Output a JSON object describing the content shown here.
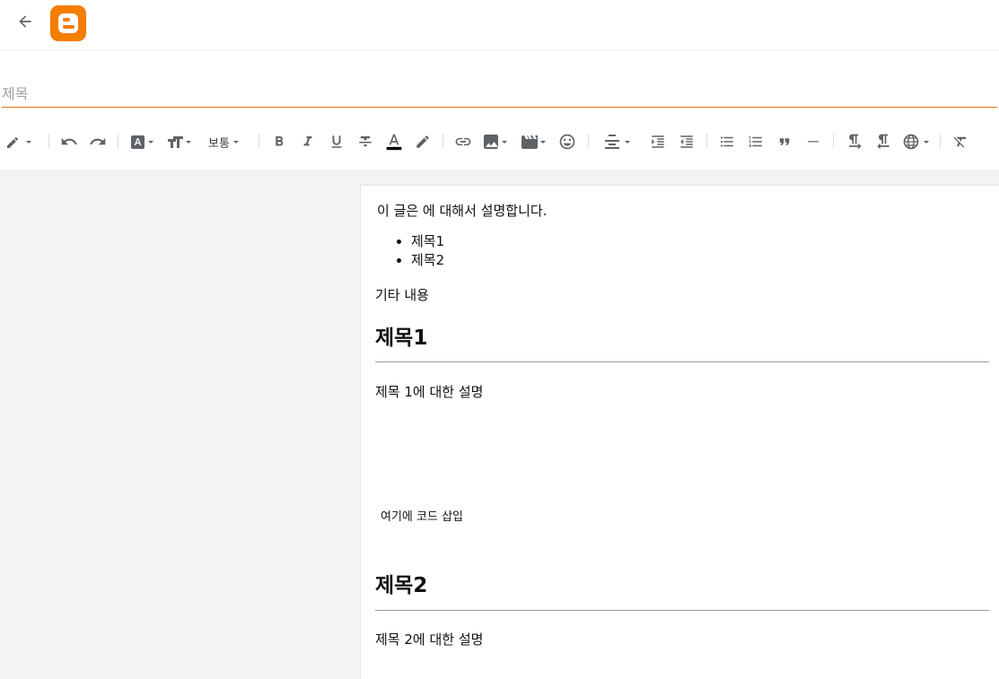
{
  "topbar": {
    "back_icon": "arrow-left-icon",
    "logo_icon": "blogger-logo-icon",
    "logo_color": "#f57d00"
  },
  "title_field": {
    "placeholder": "제목",
    "value": "",
    "underline_color": "#e8710a"
  },
  "toolbar": {
    "font_size_label": "보통",
    "icon_color": "#5f6368",
    "buttons": [
      "edit-mode",
      "undo",
      "redo",
      "font-family",
      "font-size",
      "paragraph-format",
      "bold",
      "italic",
      "underline",
      "strikethrough",
      "text-color",
      "highlight",
      "link",
      "image",
      "video",
      "emoji",
      "align",
      "indent",
      "outdent",
      "bulleted-list",
      "numbered-list",
      "quote",
      "divider",
      "ltr",
      "rtl",
      "language",
      "clear-format"
    ]
  },
  "editor": {
    "intro": " 이 글은  에 대해서 설명합니다.",
    "toc": [
      "제목1",
      "제목2"
    ],
    "etc": "기타 내용",
    "sections": [
      {
        "heading": "제목1",
        "desc": "제목 1에 대한 설명",
        "code": "여기에 코드 삽입"
      },
      {
        "heading": "제목2",
        "desc": "제목 2에 대한 설명"
      }
    ]
  }
}
